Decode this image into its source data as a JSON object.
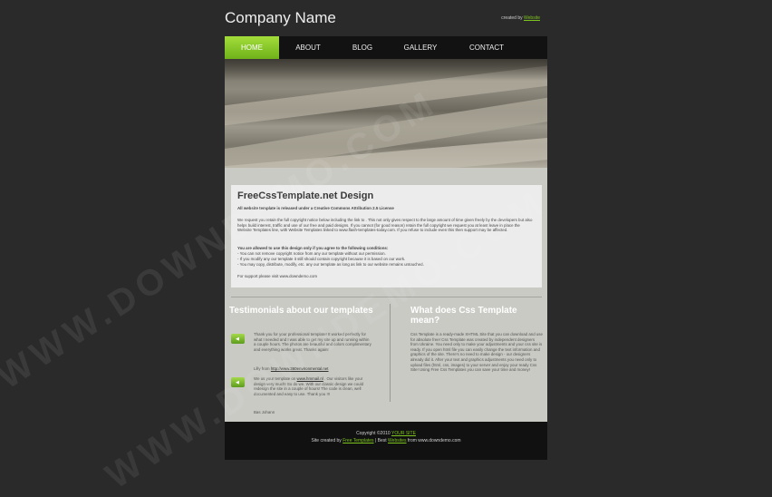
{
  "header": {
    "site_title": "Company Name",
    "credit_prefix": "created by",
    "credit_link": "Website"
  },
  "nav": {
    "items": [
      "HOME",
      "ABOUT",
      "BLOG",
      "GALLERY",
      "CONTACT"
    ],
    "active": "HOME"
  },
  "hero": {
    "image": "stone-steps-photo"
  },
  "intro": {
    "title": "FreeCssTemplate.net Design",
    "license_line": "All website template is released under a Creative Commons Attribution 2.5 License",
    "para1": "We request you retain the full copyright notice below including the link to . This not only gives respect to the large amount of time given freely by the developers but also helps build interest, traffic and use of our free and paid designs. If you cannot (for good reason) retain the full copyright we request you at least leave in place the Website Templates line, with Website Templates linked to www.flash-templates-today.com. If you refuse to include even this then support may be affected.",
    "allowed_heading": "You are allowed to use this design only if you agree to the following conditions:",
    "cond1": "- You can not remove copyright notice from any our template without our permission.",
    "cond2": "- If you modify any our template it still should contain copyright because it is based on our work.",
    "cond3": "- You may copy, distribute, modify, etc. any our template as long as link to our website remains untouched.",
    "support": "For support please visit www.downdemo.com"
  },
  "testimonials": {
    "title": "Testimonials about our templates",
    "t1_text": "Thank you for your professional template! It worked perfectly for what I needed and I was able to get my site up and running within a couple hours. The photos are beautiful and colors complimentary and everything works great. Thanks again!",
    "t1_author_prefix": "Lilly from",
    "t1_author_link": "http://www.360environmental.net",
    "t2_intro": "We us your template on",
    "t2_link": "www.hmmail.nl",
    "t2_text": ". Our visitors like your design very much! So do we. With our classic design we could redesign the site in a couple of hours! The code is clean, well documented and easy to use. Thank you !!!",
    "t2_author": "Bas Johann"
  },
  "about": {
    "title": "What does Css Template mean?",
    "text": "Css Template is a ready-made XHTML Site that you can download and use for absolute free! Css Template was created by independent designers from Ukraine. You need only to make your adjustments and your css site is ready. If you open html file you can easily change the text information and graphics of the site. There's no need to make design - our designers already did it. After your text and graphics adjustments you need only to upload files (html, css, images) to your server and enjoy your ready Css Site! Using Free Css Templates you can save your time and money!"
  },
  "footer": {
    "line1_prefix": "Copyright ©2010",
    "line1_link": "YOUR SITE",
    "line2_prefix": "Site created by",
    "line2_link1": "Free Templates",
    "line2_mid": "| Best",
    "line2_link2": "Websites",
    "line2_suffix": "from www.downdemo.com"
  },
  "watermark": {
    "text": "WWW.DOWNDEMO.COM"
  },
  "colors": {
    "accent": "#7ec41e",
    "nav_bg": "#121212",
    "page_bg": "#2a2a2a",
    "content_bg": "#c9cac4"
  }
}
